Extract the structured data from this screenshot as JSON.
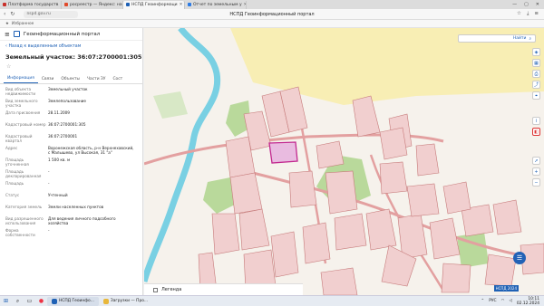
{
  "browser": {
    "tabs": [
      {
        "label": "Платформа государств",
        "color": "#c9312b"
      },
      {
        "label": "росреестр — Яндекс: на",
        "color": "#e14a2b"
      },
      {
        "label": "НСПД Геоинформаци",
        "color": "#1f61b5",
        "active": true
      },
      {
        "label": "Отчет по земельным у",
        "color": "#2c7be5"
      }
    ],
    "window_controls": [
      "—",
      "▢",
      "✕"
    ],
    "url": "nspd.gov.ru",
    "page_title": "НСПД Геоинформационный портал",
    "bookmarks_label": "Избранное"
  },
  "panel": {
    "header_title": "Геоинформационный портал",
    "back_link": "Назад к выделенным объектам",
    "title": "Земельный участок: 36:07:2700001:305",
    "star_icon": "☆",
    "tabs": [
      "Информация",
      "Связи",
      "Объекты",
      "Части ЗУ",
      "Сост"
    ],
    "active_tab": 0,
    "fields": [
      {
        "key": "Вид объекта недвижимости",
        "value": "Земельный участок"
      },
      {
        "key": "Вид земельного участка",
        "value": "Землепользование"
      },
      {
        "key": "Дата присвоения",
        "value": "28.11.2009"
      },
      {
        "key": "Кадастровый номер",
        "value": "36:07:2700001:305"
      },
      {
        "key": "Кадастровый квартал",
        "value": "36:07:2700001"
      },
      {
        "key": "Адрес",
        "value": "Воронежская область, р-н Верхнехавский, с Малышево, ул Высокая, 31 \"а\""
      },
      {
        "key": "Площадь уточненная",
        "value": "1 500 кв. м"
      },
      {
        "key": "Площадь декларированная",
        "value": "-"
      },
      {
        "key": "Площадь",
        "value": "-"
      },
      {
        "key": "Статус",
        "value": "Учтенный"
      },
      {
        "key": "Категория земель",
        "value": "Земли населенных пунктов"
      },
      {
        "key": "Вид разрешенного использования",
        "value": "Для ведения личного подсобного хозяйства"
      },
      {
        "key": "Форма собственности",
        "value": "-"
      }
    ]
  },
  "map": {
    "search_label": "Найти",
    "legend_label": "Легенда",
    "scale_label": "НСПД 2024",
    "fab_icon": "☰"
  },
  "taskbar": {
    "apps": [
      {
        "label": "НСПД Геоинфо...",
        "color": "#1f61b5",
        "active": true
      },
      {
        "label": "Загрузки — Про...",
        "color": "#e8b73a",
        "active": false
      }
    ],
    "time": "10:11",
    "date": "02.12.2024",
    "lang": "РУС"
  },
  "colors": {
    "accent": "#1f61b5",
    "parcel": "#f1cfcf",
    "selected": "#d54aa3",
    "river": "#79d0e3"
  }
}
